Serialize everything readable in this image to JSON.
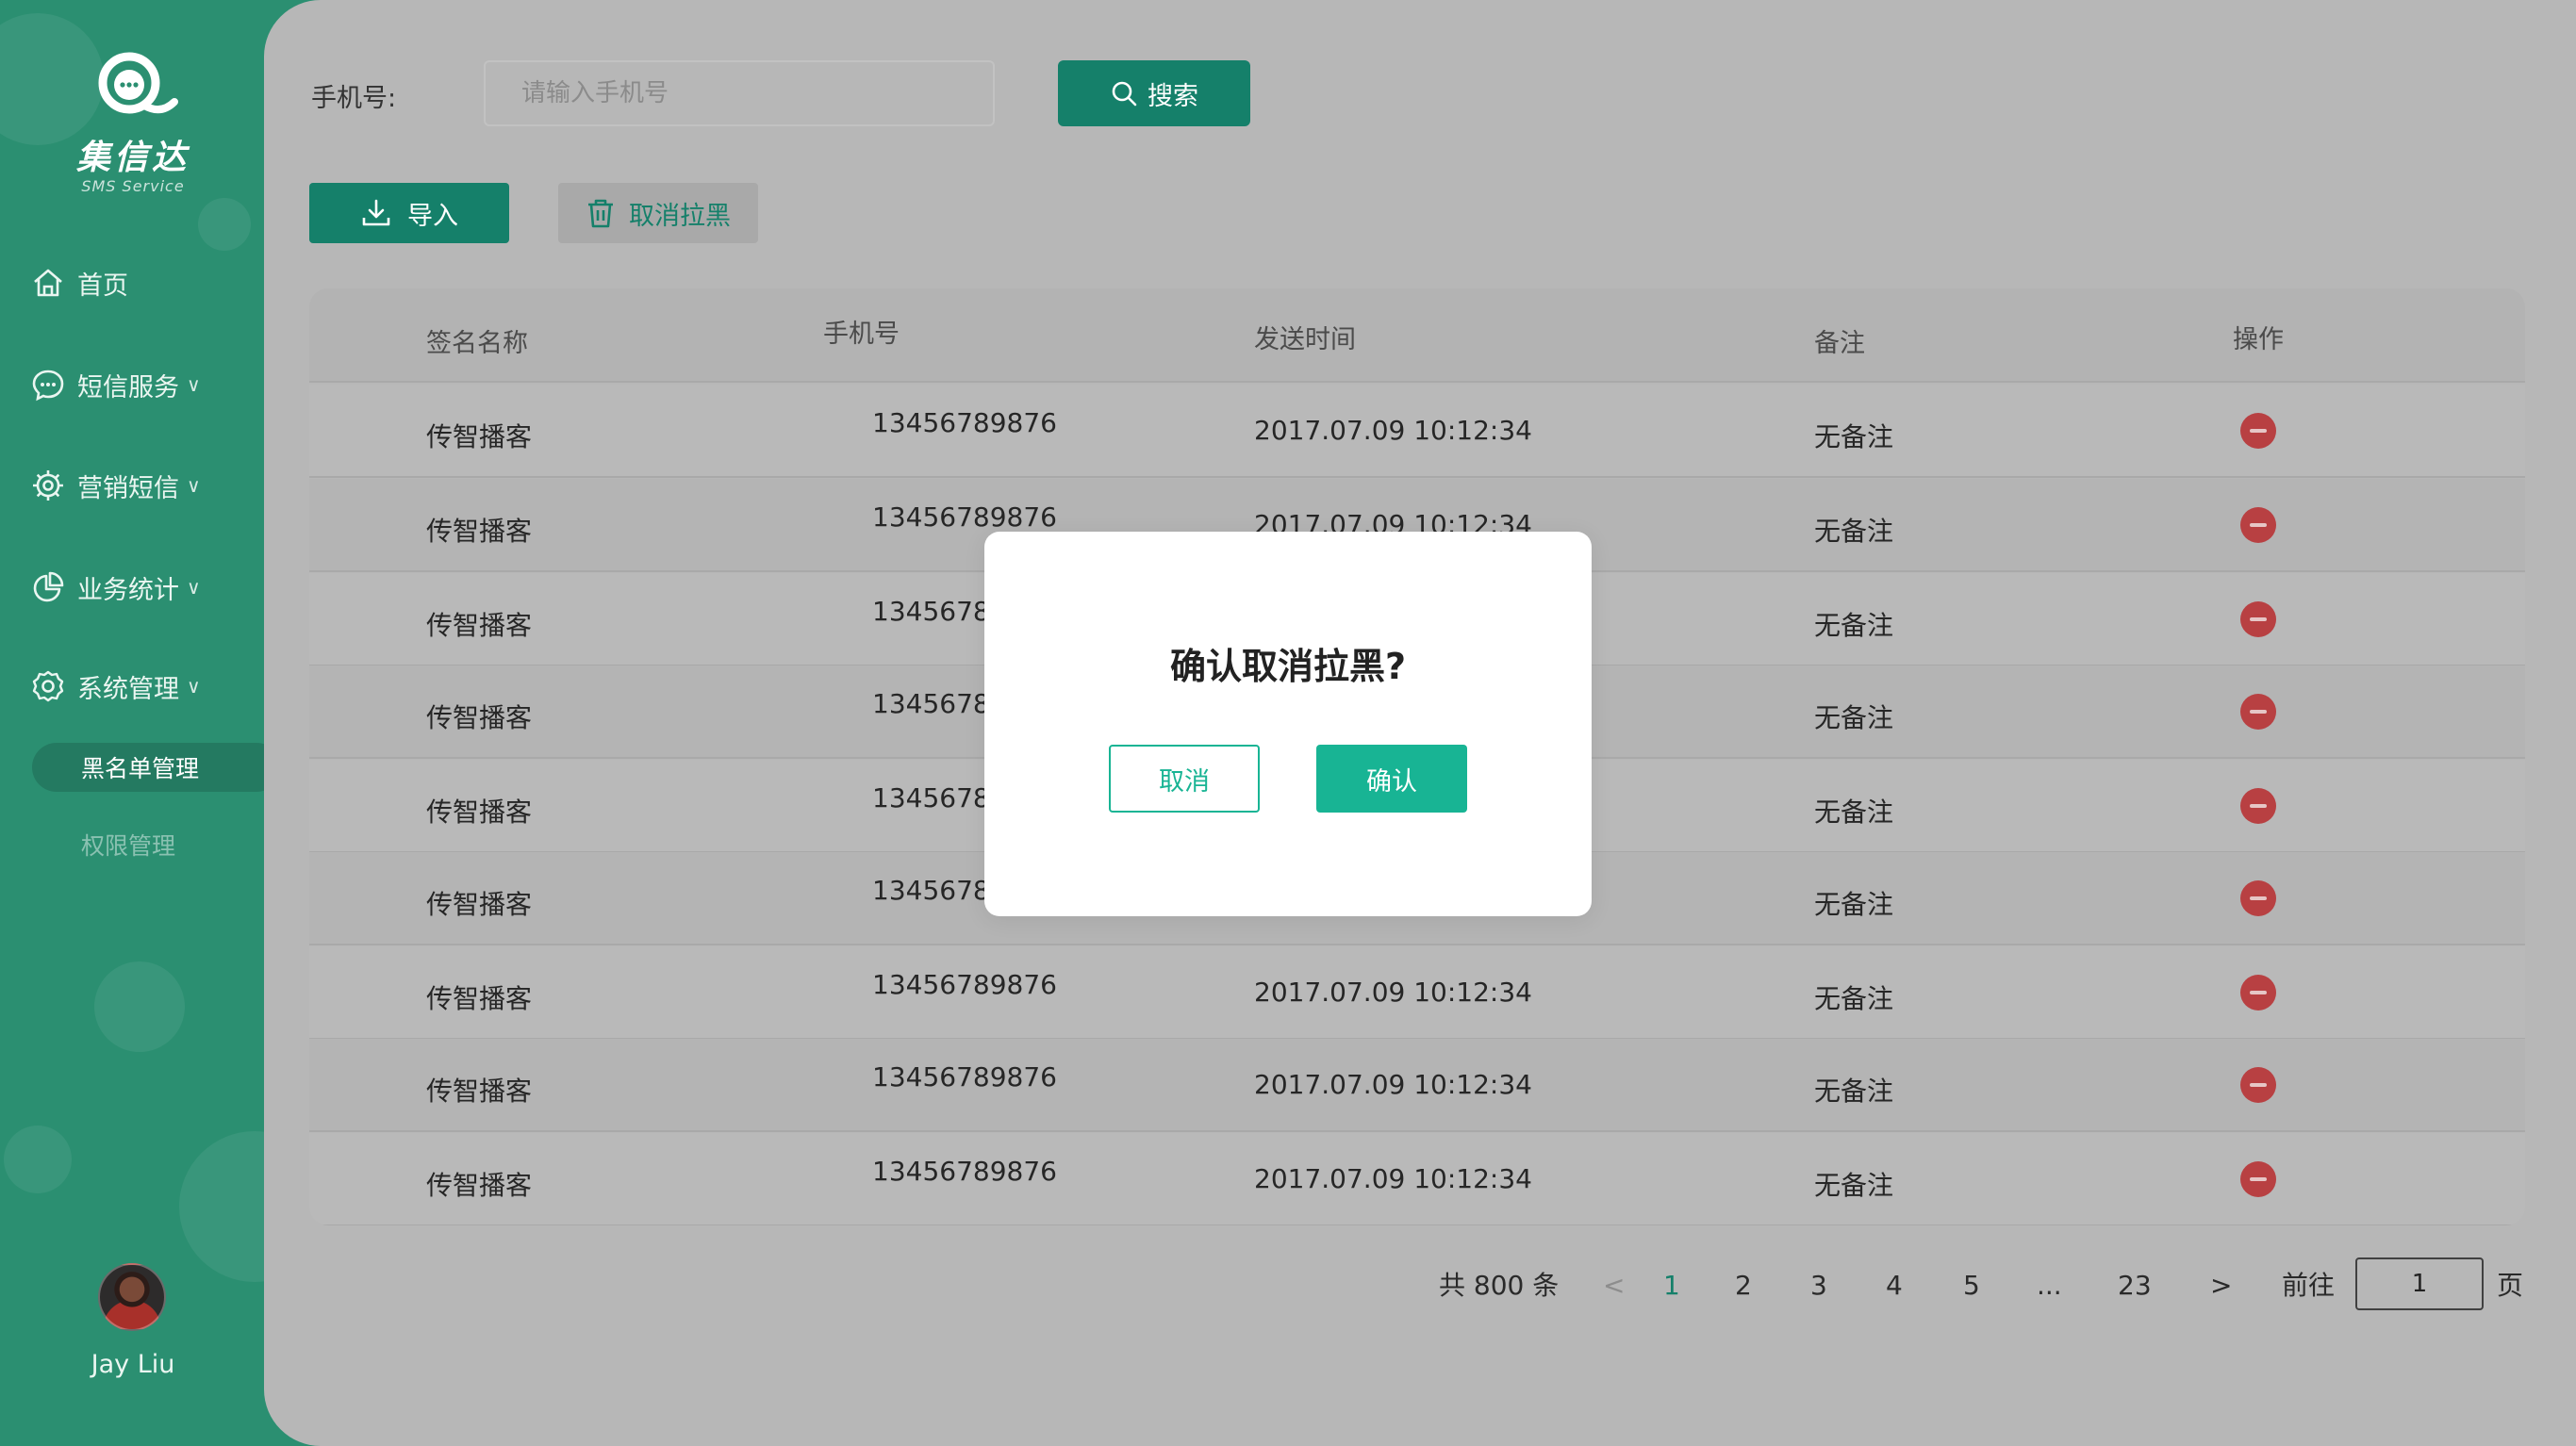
{
  "brand": {
    "name": "集信达",
    "subtitle": "SMS Service",
    "accent": "#15806a",
    "sidebar_bg": "#2b8f71"
  },
  "sidebar": {
    "items": [
      {
        "label": "首页",
        "icon": "home-icon"
      },
      {
        "label": "短信服务",
        "icon": "chat-icon"
      },
      {
        "label": "营销短信",
        "icon": "marketing-gear-icon"
      },
      {
        "label": "业务统计",
        "icon": "pie-chart-icon"
      },
      {
        "label": "系统管理",
        "icon": "settings-icon"
      }
    ],
    "sub_items": [
      {
        "label": "黑名单管理",
        "active": true
      },
      {
        "label": "权限管理",
        "active": false
      }
    ],
    "chevron": "∨",
    "user": {
      "name": "Jay Liu"
    }
  },
  "search": {
    "label": "手机号:",
    "placeholder": "请输入手机号",
    "button_label": "搜索"
  },
  "toolbar": {
    "import_label": "导入",
    "unblock_label": "取消拉黑"
  },
  "table": {
    "columns": [
      "签名名称",
      "手机号",
      "发送时间",
      "备注",
      "操作"
    ],
    "rows": [
      {
        "sign": "传智播客",
        "phone": "13456789876",
        "time": "2017.07.09 10:12:34",
        "note": "无备注"
      },
      {
        "sign": "传智播客",
        "phone": "13456789876",
        "time": "2017.07.09 10:12:34",
        "note": "无备注"
      },
      {
        "sign": "传智播客",
        "phone": "13456789876",
        "time": "",
        "note": "无备注"
      },
      {
        "sign": "传智播客",
        "phone": "13456789876",
        "time": "",
        "note": "无备注"
      },
      {
        "sign": "传智播客",
        "phone": "13456789876",
        "time": "",
        "note": "无备注"
      },
      {
        "sign": "传智播客",
        "phone": "13456789876",
        "time": "",
        "note": "无备注"
      },
      {
        "sign": "传智播客",
        "phone": "13456789876",
        "time": "2017.07.09 10:12:34",
        "note": "无备注"
      },
      {
        "sign": "传智播客",
        "phone": "13456789876",
        "time": "2017.07.09 10:12:34",
        "note": "无备注"
      },
      {
        "sign": "传智播客",
        "phone": "13456789876",
        "time": "2017.07.09 10:12:34",
        "note": "无备注"
      }
    ]
  },
  "pagination": {
    "total_label": "共 800 条",
    "prev": "<",
    "next": ">",
    "pages": [
      "1",
      "2",
      "3",
      "4",
      "5",
      "...",
      "23"
    ],
    "current": "1",
    "goto_label": "前往",
    "goto_value": "1",
    "page_unit": "页"
  },
  "modal": {
    "title": "确认取消拉黑?",
    "cancel_label": "取消",
    "confirm_label": "确认",
    "confirm_color": "#18b494"
  }
}
